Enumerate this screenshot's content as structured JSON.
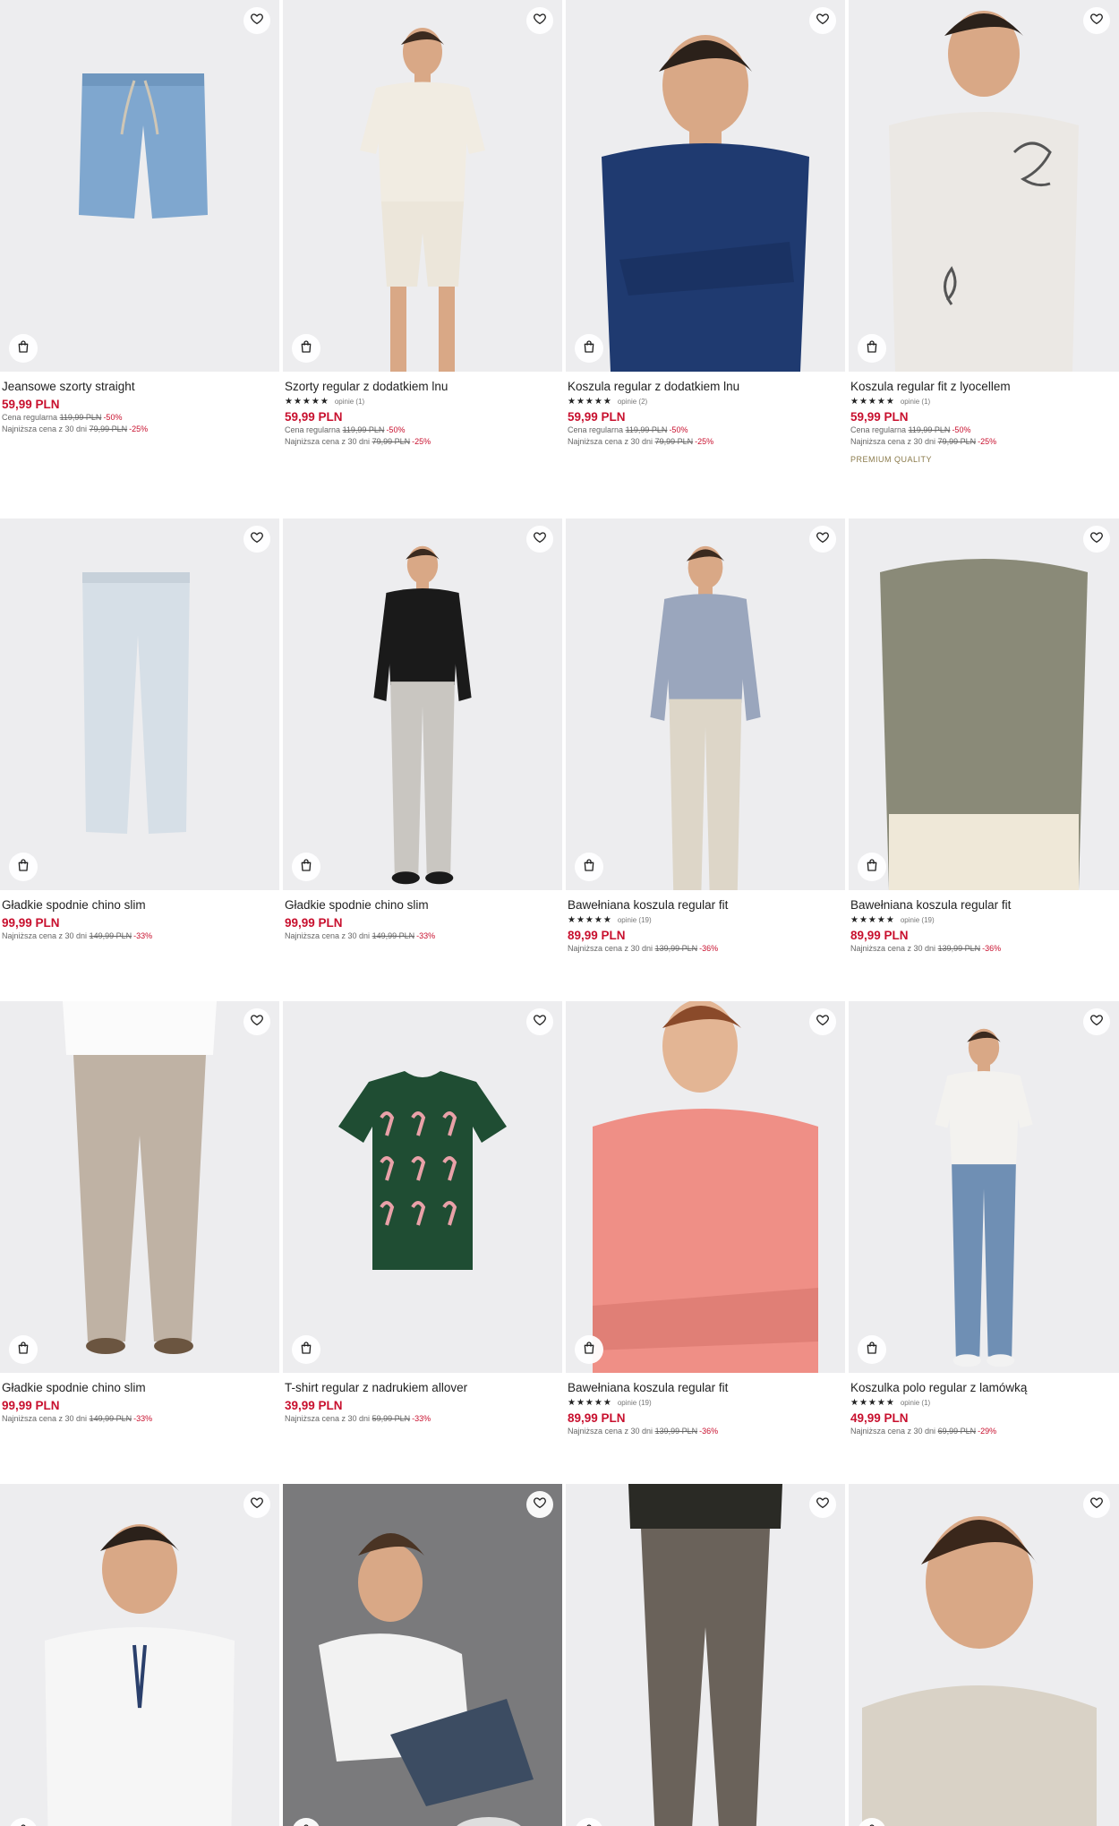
{
  "ui": {
    "favorite_icon": "heart-icon",
    "cart_icon": "shopping-bag-icon",
    "rating_glyphs": "★★★★★"
  },
  "rows": [
    {
      "products": [
        {
          "title": "Jeansowe szorty straight",
          "price": "59,99 PLN",
          "regular_label": "Cena regularna",
          "regular_price": "119,99 PLN",
          "regular_discount": "-50%",
          "lowest_label": "Najniższa cena z 30 dni",
          "lowest_price": "79,99 PLN",
          "lowest_discount": "-25%",
          "image": "denim-shorts"
        },
        {
          "title": "Szorty regular z dodatkiem lnu",
          "reviews": "opinie (1)",
          "price": "59,99 PLN",
          "regular_label": "Cena regularna",
          "regular_price": "119,99 PLN",
          "regular_discount": "-50%",
          "lowest_label": "Najniższa cena z 30 dni",
          "lowest_price": "79,99 PLN",
          "lowest_discount": "-25%",
          "image": "man-linen-outfit"
        },
        {
          "title": "Koszula regular z dodatkiem lnu",
          "reviews": "opinie (2)",
          "price": "59,99 PLN",
          "regular_label": "Cena regularna",
          "regular_price": "119,99 PLN",
          "regular_discount": "-50%",
          "lowest_label": "Najniższa cena z 30 dni",
          "lowest_price": "79,99 PLN",
          "lowest_discount": "-25%",
          "image": "man-navy-shirt"
        },
        {
          "title": "Koszula regular fit z lyocellem",
          "reviews": "opinie (1)",
          "price": "59,99 PLN",
          "regular_label": "Cena regularna",
          "regular_price": "119,99 PLN",
          "regular_discount": "-50%",
          "lowest_label": "Najniższa cena z 30 dni",
          "lowest_price": "79,99 PLN",
          "lowest_discount": "-25%",
          "badge": "PREMIUM QUALITY",
          "image": "man-printed-shirt"
        }
      ]
    },
    {
      "products": [
        {
          "title": "Gładkie spodnie chino slim",
          "price": "99,99 PLN",
          "lowest_label": "Najniższa cena z 30 dni",
          "lowest_price": "149,99 PLN",
          "lowest_discount": "-33%",
          "image": "light-chinos"
        },
        {
          "title": "Gładkie spodnie chino slim",
          "price": "99,99 PLN",
          "lowest_label": "Najniższa cena z 30 dni",
          "lowest_price": "149,99 PLN",
          "lowest_discount": "-33%",
          "image": "man-black-sweater"
        },
        {
          "title": "Bawełniana koszula regular fit",
          "reviews": "opinie (19)",
          "price": "89,99 PLN",
          "lowest_label": "Najniższa cena z 30 dni",
          "lowest_price": "139,99 PLN",
          "lowest_discount": "-36%",
          "image": "man-patterned-shirt"
        },
        {
          "title": "Bawełniana koszula regular fit",
          "reviews": "opinie (19)",
          "price": "89,99 PLN",
          "lowest_label": "Najniższa cena z 30 dni",
          "lowest_price": "139,99 PLN",
          "lowest_discount": "-36%",
          "image": "man-olive-shirt"
        }
      ]
    },
    {
      "products": [
        {
          "title": "Gładkie spodnie chino slim",
          "price": "99,99 PLN",
          "lowest_label": "Najniższa cena z 30 dni",
          "lowest_price": "149,99 PLN",
          "lowest_discount": "-33%",
          "image": "man-beige-chinos"
        },
        {
          "title": "T-shirt regular z nadrukiem allover",
          "price": "39,99 PLN",
          "lowest_label": "Najniższa cena z 30 dni",
          "lowest_price": "59,99 PLN",
          "lowest_discount": "-33%",
          "image": "flamingo-tshirt"
        },
        {
          "title": "Bawełniana koszula regular fit",
          "reviews": "opinie (19)",
          "price": "89,99 PLN",
          "lowest_label": "Najniższa cena z 30 dni",
          "lowest_price": "139,99 PLN",
          "lowest_discount": "-36%",
          "image": "man-pink-shirt"
        },
        {
          "title": "Koszulka polo regular z lamówką",
          "reviews": "opinie (1)",
          "price": "49,99 PLN",
          "lowest_label": "Najniższa cena z 30 dni",
          "lowest_price": "69,99 PLN",
          "lowest_discount": "-29%",
          "image": "man-polo-jeans"
        }
      ]
    },
    {
      "products": [
        {
          "image": "man-white-polo"
        },
        {
          "image": "man-seated-shorts"
        },
        {
          "image": "man-brown-trousers"
        },
        {
          "image": "man-linen-shirt-closeup"
        }
      ]
    }
  ]
}
